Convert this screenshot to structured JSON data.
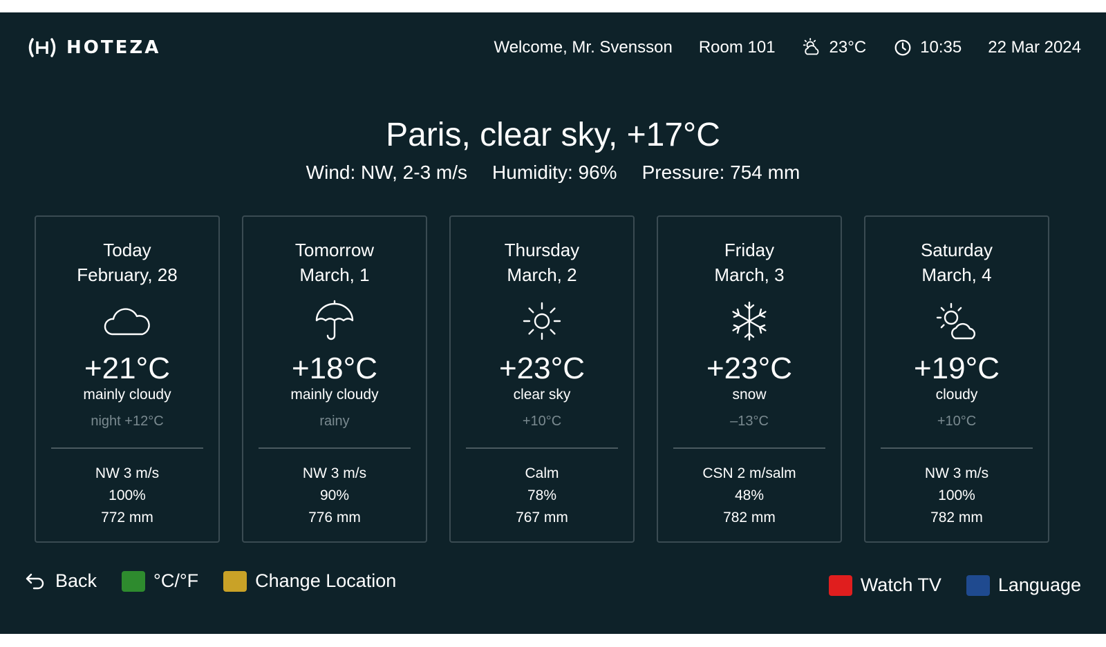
{
  "brand": {
    "name": "HOTEZA"
  },
  "status": {
    "welcome": "Welcome, Mr. Svensson",
    "room": "Room 101",
    "weather_icon": "partly-cloudy-icon",
    "temperature": "23°C",
    "clock_icon": "clock-icon",
    "time": "10:35",
    "date": "22 Mar 2024"
  },
  "current": {
    "title": "Paris, clear sky, +17°C",
    "wind": "Wind: NW, 2-3 m/s",
    "humidity": "Humidity: 96%",
    "pressure": "Pressure: 754 mm"
  },
  "forecast": [
    {
      "day": "Today",
      "date": "February, 28",
      "icon": "cloud-icon",
      "temp": "+21°C",
      "condition": "mainly cloudy",
      "secondary": "night +12°C",
      "wind": "NW 3 m/s",
      "humidity": "100%",
      "pressure": "772 mm"
    },
    {
      "day": "Tomorrow",
      "date": "March, 1",
      "icon": "umbrella-icon",
      "temp": "+18°C",
      "condition": "mainly cloudy",
      "secondary": "rainy",
      "wind": "NW 3 m/s",
      "humidity": "90%",
      "pressure": "776 mm"
    },
    {
      "day": "Thursday",
      "date": "March, 2",
      "icon": "sun-icon",
      "temp": "+23°C",
      "condition": "clear sky",
      "secondary": "+10°C",
      "wind": "Calm",
      "humidity": "78%",
      "pressure": "767 mm"
    },
    {
      "day": "Friday",
      "date": "March, 3",
      "icon": "snowflake-icon",
      "temp": "+23°C",
      "condition": "snow",
      "secondary": "–13°C",
      "wind": "CSN 2 m/salm",
      "humidity": "48%",
      "pressure": "782 mm"
    },
    {
      "day": "Saturday",
      "date": "March, 4",
      "icon": "partly-cloudy-icon",
      "temp": "+19°C",
      "condition": "cloudy",
      "secondary": "+10°C",
      "wind": "NW 3 m/s",
      "humidity": "100%",
      "pressure": "782 mm"
    }
  ],
  "footer": {
    "back_label": "Back",
    "units_label": "°C/°F",
    "location_label": "Change Location",
    "tv_label": "Watch TV",
    "language_label": "Language"
  },
  "colors": {
    "background": "#0e2229",
    "green": "#2e8b2e",
    "yellow": "#c9a227",
    "red": "#e01e1e",
    "blue": "#1f4a8f"
  }
}
